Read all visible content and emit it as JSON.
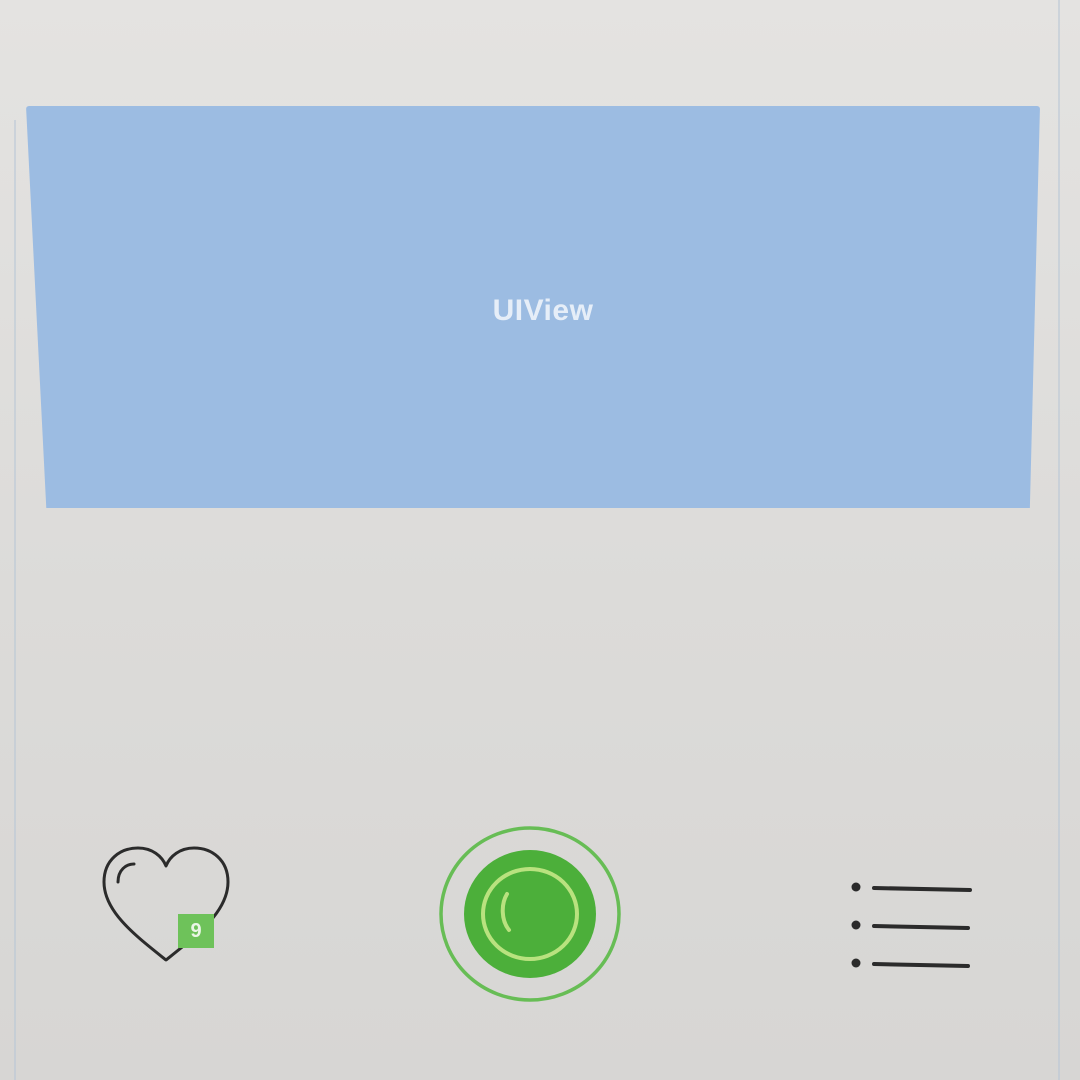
{
  "main": {
    "view_label": "UIView"
  },
  "toolbar": {
    "favorites": {
      "icon": "heart-icon",
      "badge_count": "9"
    },
    "record": {
      "icon": "record-button-icon"
    },
    "menu": {
      "icon": "list-menu-icon"
    }
  },
  "colors": {
    "view_background": "#9cbce2",
    "view_label": "#e6eef8",
    "accent_green": "#4caf3a",
    "badge_green": "#6ec25a",
    "icon_stroke": "#2b2b2b",
    "background": "#dcdbd9"
  }
}
